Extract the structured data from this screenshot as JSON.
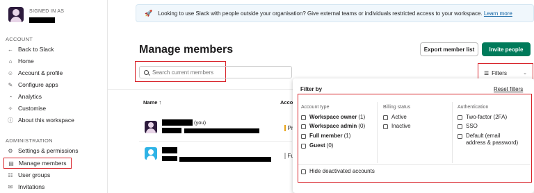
{
  "sidebar": {
    "signed_in_label": "SIGNED IN AS",
    "account_header": "ACCOUNT",
    "account_items": [
      {
        "label": "Back to Slack",
        "icon": "←"
      },
      {
        "label": "Home",
        "icon": "⌂"
      },
      {
        "label": "Account & profile",
        "icon": "☺"
      },
      {
        "label": "Configure apps",
        "icon": "✎"
      },
      {
        "label": "Analytics",
        "icon": "◔"
      },
      {
        "label": "Customise",
        "icon": "✧"
      },
      {
        "label": "About this workspace",
        "icon": "ⓘ"
      }
    ],
    "admin_header": "ADMINISTRATION",
    "admin_items": [
      {
        "label": "Settings & permissions",
        "icon": "⚙"
      },
      {
        "label": "Manage members",
        "icon": "▤"
      },
      {
        "label": "User groups",
        "icon": "☷"
      },
      {
        "label": "Invitations",
        "icon": "✉"
      }
    ]
  },
  "banner": {
    "text": "Looking to use Slack with people outside your organisation? Give external teams or individuals restricted access to your workspace.",
    "link": "Learn more"
  },
  "main": {
    "title": "Manage members",
    "export_label": "Export member list",
    "invite_label": "Invite people",
    "search_placeholder": "Search current members",
    "filters_label": "Filters",
    "col_name": "Name ↑",
    "col_account": "Acco",
    "row1_you": "(you)",
    "row1_account": "Pri",
    "row2_account": "Ful"
  },
  "filter_panel": {
    "title": "Filter by",
    "reset": "Reset filters",
    "account_type_header": "Account type",
    "account_types": [
      {
        "label": "Workspace owner",
        "count": "(1)"
      },
      {
        "label": "Workspace admin",
        "count": "(0)"
      },
      {
        "label": "Full member",
        "count": "(1)"
      },
      {
        "label": "Guest",
        "count": "(0)"
      }
    ],
    "billing_header": "Billing status",
    "billing": [
      "Active",
      "Inactive"
    ],
    "auth_header": "Authentication",
    "auth": [
      "Two-factor (2FA)",
      "SSO",
      "Default (email address & password)"
    ],
    "hide_deactivated": "Hide deactivated accounts"
  }
}
